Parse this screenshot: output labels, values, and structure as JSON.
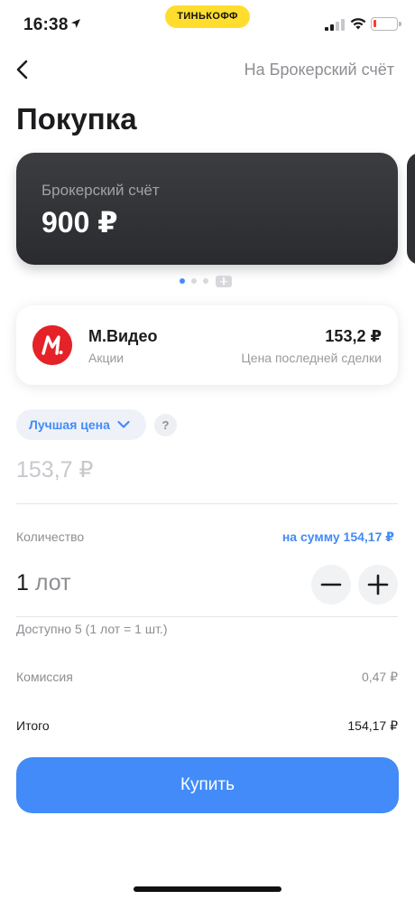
{
  "status_bar": {
    "time": "16:38",
    "brand": "ТИНЬКОФФ",
    "battery_level_percent": 12
  },
  "nav": {
    "link": "На Брокерский счёт"
  },
  "page": {
    "title": "Покупка"
  },
  "account": {
    "name": "Брокерский счёт",
    "balance": "900 ₽",
    "pager_pages": 3,
    "pager_active": 1
  },
  "instrument": {
    "name": "М.Видео",
    "type": "Акции",
    "price": "153,2 ₽",
    "price_label": "Цена последней сделки",
    "logo_letter": "М",
    "logo_color": "#e42227"
  },
  "order": {
    "price_type": "Лучшая цена",
    "help": "?",
    "price": "153,7 ₽",
    "quantity_label": "Количество",
    "quantity_sum": "на сумму 154,17 ₽",
    "quantity_number": "1",
    "quantity_unit": "лот",
    "available": "Доступно 5 (1 лот = 1 шт.)",
    "commission_label": "Комиссия",
    "commission_value": "0,47 ₽",
    "total_label": "Итого",
    "total_value": "154,17 ₽",
    "buy_label": "Купить"
  },
  "colors": {
    "accent": "#428bf9",
    "brand_yellow": "#ffdd2d",
    "card_dark": "#2f3034"
  },
  "icons": [
    "location-arrow-icon",
    "signal-icon",
    "wifi-icon",
    "battery-icon",
    "back-chevron-icon",
    "chevron-down-icon",
    "minus-icon",
    "plus-icon"
  ]
}
